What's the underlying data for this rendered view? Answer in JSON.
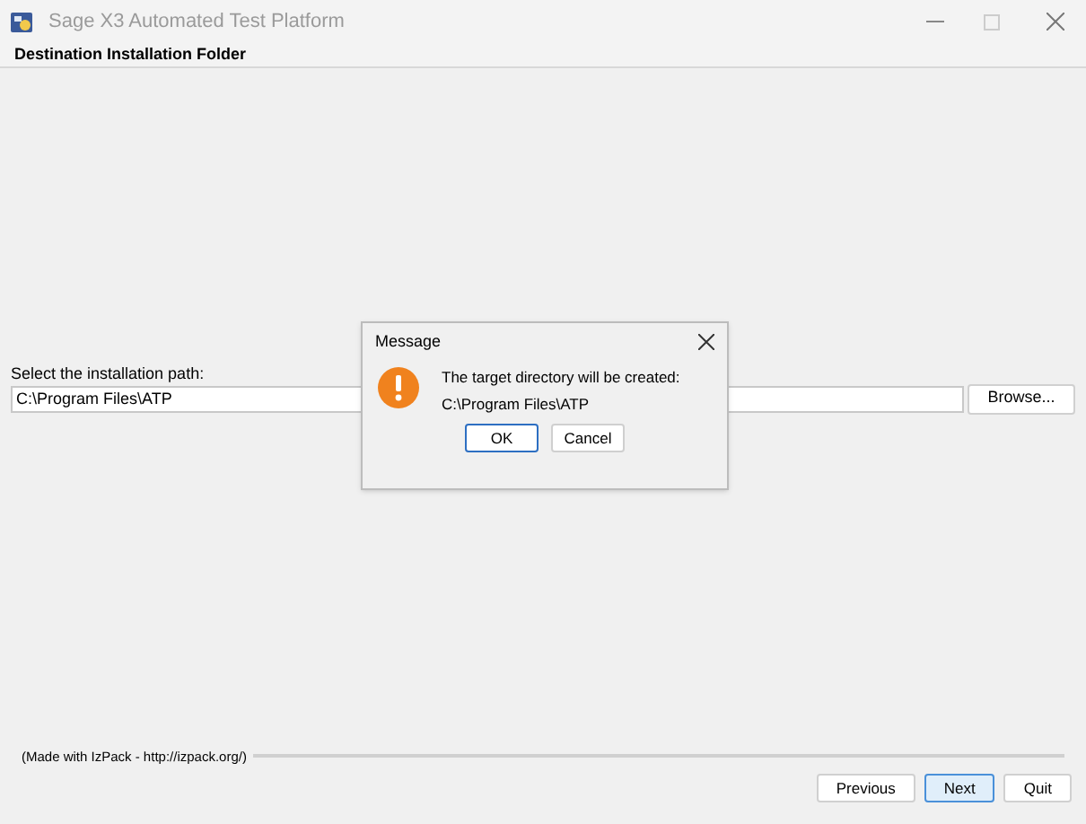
{
  "window": {
    "title": "Sage X3 Automated Test Platform"
  },
  "header": "Destination Installation Folder",
  "path_label": "Select the installation path:",
  "path_field": {
    "value": "C:\\Program Files\\ATP"
  },
  "browse_button": "Browse...",
  "footer_note": "(Made with IzPack - http://izpack.org/)",
  "nav_buttons": [
    {
      "label": "Previous",
      "selected": false
    },
    {
      "label": "Next",
      "selected": true
    },
    {
      "label": "Quit",
      "selected": false
    }
  ],
  "dialog": {
    "title": "Message",
    "message": "The target directory will be created:",
    "path": "C:\\Program Files\\ATP",
    "buttons": [
      {
        "label": "OK",
        "selected": true
      },
      {
        "label": "Cancel",
        "selected": false
      }
    ]
  }
}
